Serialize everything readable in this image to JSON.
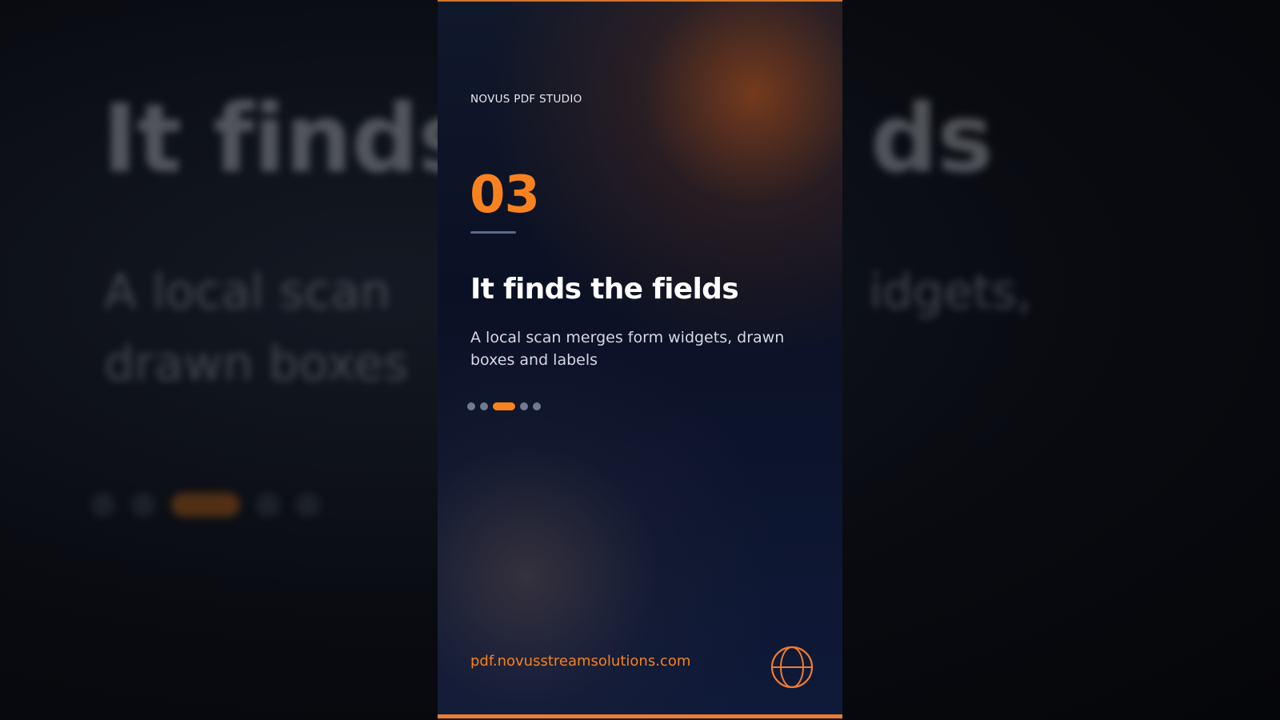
{
  "background": {
    "title": "It finds",
    "title_right": "ds",
    "subtitle_left_line1": "A local scan",
    "subtitle_right_line1": "idgets,",
    "subtitle_left_line2": "drawn boxes"
  },
  "slide": {
    "brand": "NOVUS PDF STUDIO",
    "step_number": "03",
    "title": "It finds the fields",
    "subtitle": "A local scan merges form widgets, drawn boxes and labels",
    "pagination": {
      "total": 5,
      "active_index": 2
    },
    "url": "pdf.novusstreamsolutions.com",
    "logo_icon": "globe-icon"
  },
  "colors": {
    "accent": "#f7821f",
    "card_background": "#0b1124",
    "inactive_dot": "#6f7a93"
  }
}
